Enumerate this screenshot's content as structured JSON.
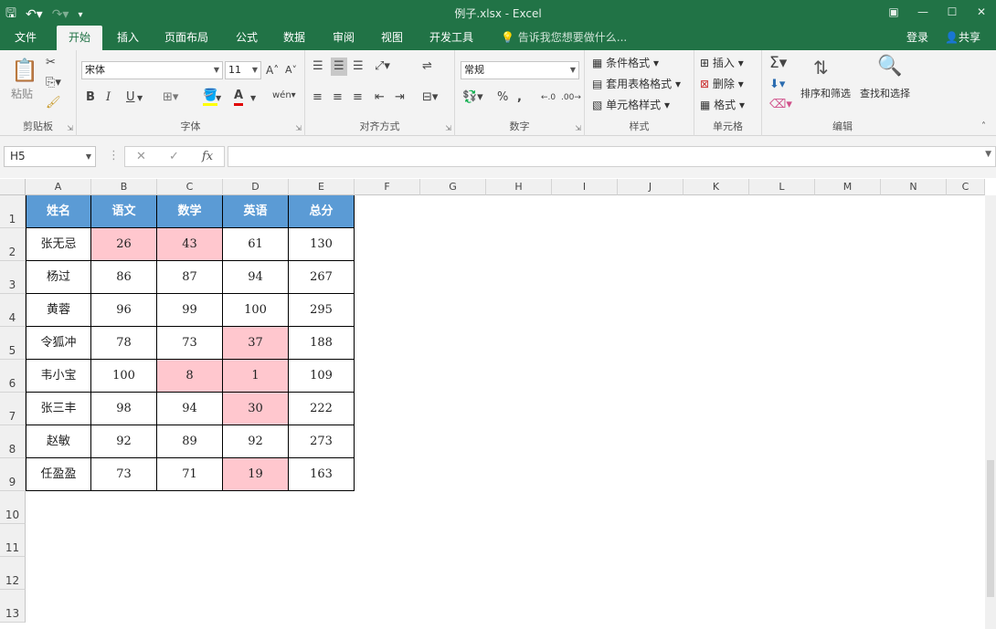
{
  "window": {
    "title": "例子.xlsx - Excel"
  },
  "tabs": [
    {
      "label": "文件",
      "active": false
    },
    {
      "label": "开始",
      "active": true
    },
    {
      "label": "插入",
      "active": false
    },
    {
      "label": "页面布局",
      "active": false
    },
    {
      "label": "公式",
      "active": false
    },
    {
      "label": "数据",
      "active": false
    },
    {
      "label": "审阅",
      "active": false
    },
    {
      "label": "视图",
      "active": false
    },
    {
      "label": "开发工具",
      "active": false
    }
  ],
  "tell_me": "告诉我您想要做什么...",
  "account": {
    "login": "登录",
    "share": "共享"
  },
  "ribbon": {
    "clipboard": {
      "label": "剪贴板",
      "paste": "粘贴"
    },
    "font": {
      "label": "字体",
      "font_name": "宋体",
      "font_size": "11",
      "bold": "B",
      "italic": "I",
      "underline": "U"
    },
    "alignment": {
      "label": "对齐方式"
    },
    "number": {
      "label": "数字",
      "format": "常规"
    },
    "styles": {
      "label": "样式",
      "conditional": "条件格式",
      "table": "套用表格格式",
      "cell_styles": "单元格样式"
    },
    "cells": {
      "label": "单元格",
      "insert": "插入",
      "delete": "删除",
      "format": "格式"
    },
    "editing": {
      "label": "编辑",
      "sort_filter": "排序和筛选",
      "find_select": "查找和选择"
    }
  },
  "name_box": "H5",
  "fx_symbol": "fx",
  "columns": [
    "A",
    "B",
    "C",
    "D",
    "E",
    "F",
    "G",
    "H",
    "I",
    "J",
    "K",
    "L",
    "M",
    "N",
    "C"
  ],
  "rows": [
    "1",
    "2",
    "3",
    "4",
    "5",
    "6",
    "7",
    "8",
    "9",
    "10",
    "11",
    "12",
    "13"
  ],
  "table": {
    "header": [
      "姓名",
      "语文",
      "数学",
      "英语",
      "总分"
    ],
    "rows": [
      [
        "张无忌",
        "26",
        "43",
        "61",
        "130"
      ],
      [
        "杨过",
        "86",
        "87",
        "94",
        "267"
      ],
      [
        "黄蓉",
        "96",
        "99",
        "100",
        "295"
      ],
      [
        "令狐冲",
        "78",
        "73",
        "37",
        "188"
      ],
      [
        "韦小宝",
        "100",
        "8",
        "1",
        "109"
      ],
      [
        "张三丰",
        "98",
        "94",
        "30",
        "222"
      ],
      [
        "赵敏",
        "92",
        "89",
        "92",
        "273"
      ],
      [
        "任盈盈",
        "73",
        "71",
        "19",
        "163"
      ]
    ],
    "highlight_color": "#ffc7ce",
    "header_color": "#5b9bd5"
  }
}
